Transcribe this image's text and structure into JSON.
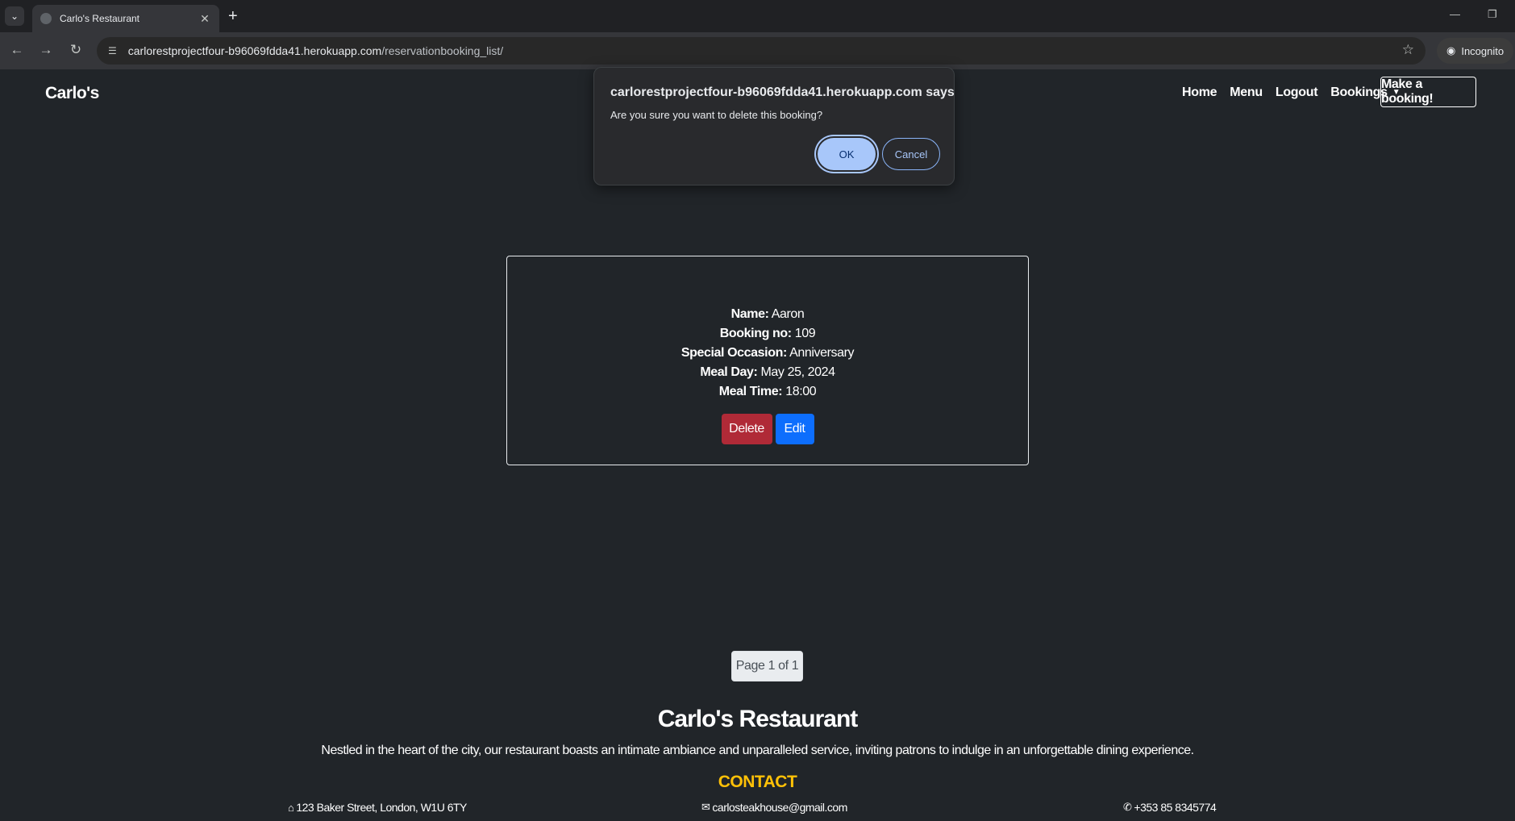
{
  "browser": {
    "tab_title": "Carlo's Restaurant",
    "url_host": "carlorestprojectfour-b96069fdda41.herokuapp.com",
    "url_path": "/reservationbooking_list/",
    "incognito_label": "Incognito"
  },
  "navbar": {
    "brand": "Carlo's",
    "links": [
      "Home",
      "Menu",
      "Logout",
      "Bookings"
    ],
    "cta": "Make a booking!"
  },
  "dialog": {
    "title": "carlorestprojectfour-b96069fdda41.herokuapp.com says",
    "message": "Are you sure you want to delete this booking?",
    "ok": "OK",
    "cancel": "Cancel"
  },
  "booking": {
    "name_label": "Name:",
    "name": "Aaron",
    "number_label": "Booking no:",
    "number": "109",
    "occasion_label": "Special Occasion:",
    "occasion": "Anniversary",
    "day_label": "Meal Day:",
    "day": "May 25, 2024",
    "time_label": "Meal Time:",
    "time": "18:00",
    "delete": "Delete",
    "edit": "Edit"
  },
  "pagination": "Page 1 of 1",
  "footer": {
    "title": "Carlo's Restaurant",
    "description": "Nestled in the heart of the city, our restaurant boasts an intimate ambiance and unparalleled service, inviting patrons to indulge in an unforgettable dining experience.",
    "contact_title": "CONTACT",
    "address": "123 Baker Street, London, W1U 6TY",
    "email": "carlosteakhouse@gmail.com",
    "phone": "+353 85 8345774"
  }
}
